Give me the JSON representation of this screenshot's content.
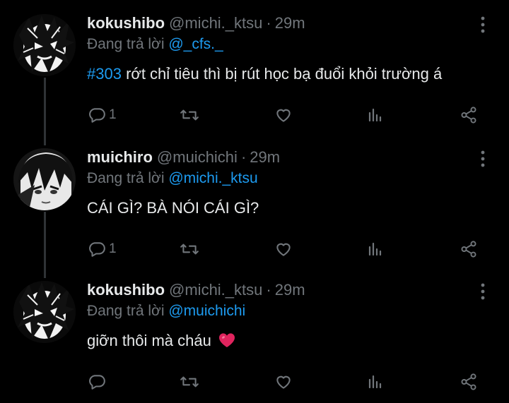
{
  "tweets": [
    {
      "name": "kokushibo",
      "handle": "@michi._ktsu",
      "separator": "·",
      "time": "29m",
      "reply_prefix": "Đang trả lời",
      "reply_to": "@_cfs._",
      "hashtag": "#303",
      "text": " rớt chỉ tiêu thì bị rút học bạ đuổi khỏi trường á",
      "reply_count": "1",
      "avatar_icon": "manga-avatar-icon"
    },
    {
      "name": "muichiro",
      "handle": "@muichichi",
      "separator": "·",
      "time": "29m",
      "reply_prefix": "Đang trả lời",
      "reply_to": "@michi._ktsu",
      "text": "CÁI GÌ? BÀ NÓI CÁI GÌ?",
      "reply_count": "1",
      "avatar_icon": "manga-avatar-icon"
    },
    {
      "name": "kokushibo",
      "handle": "@michi._ktsu",
      "separator": "·",
      "time": "29m",
      "reply_prefix": "Đang trả lời",
      "reply_to": "@muichichi",
      "text": "giỡn thôi mà cháu ",
      "emoji": "red-heart-emoji",
      "reply_count": "",
      "avatar_icon": "manga-avatar-icon"
    }
  ],
  "icons": {
    "reply": "comment-icon",
    "retweet": "retweet-icon",
    "like": "heart-icon",
    "views": "bar-chart-icon",
    "share": "share-icon",
    "more": "more-vertical-icon"
  },
  "colors": {
    "background": "#000000",
    "text": "#e7e9ea",
    "muted": "#71767b",
    "accent": "#1d9bf0",
    "thread_line": "#2f3336",
    "heart_emoji": "#e0245e"
  }
}
